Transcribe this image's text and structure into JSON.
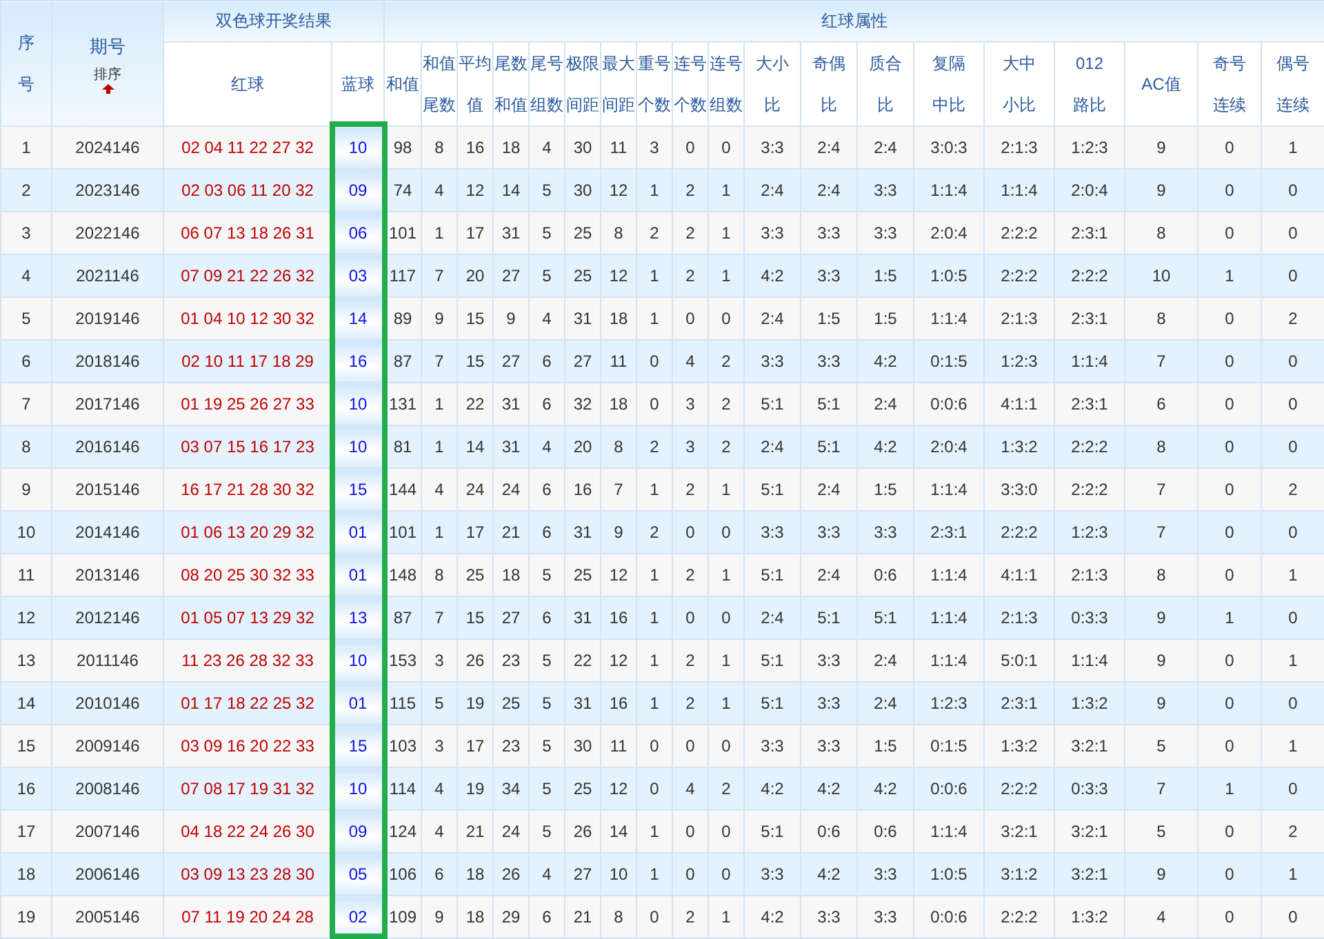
{
  "table": {
    "header": {
      "index": {
        "lines": [
          "序",
          "号"
        ]
      },
      "issue": {
        "lines": [
          "期号"
        ],
        "sort_label": "排序",
        "sort_ascending": true
      },
      "groups": [
        {
          "label": "双色球开奖结果",
          "columns": [
            {
              "lines": [
                "红球"
              ]
            },
            {
              "lines": [
                "蓝球"
              ]
            }
          ]
        },
        {
          "label": "红球属性",
          "columns": [
            {
              "lines": [
                "和值"
              ]
            },
            {
              "lines": [
                "和值",
                "尾数"
              ]
            },
            {
              "lines": [
                "平均",
                "值"
              ]
            },
            {
              "lines": [
                "尾数",
                "和值"
              ]
            },
            {
              "lines": [
                "尾号",
                "组数"
              ]
            },
            {
              "lines": [
                "极限",
                "间距"
              ]
            },
            {
              "lines": [
                "最大",
                "间距"
              ]
            },
            {
              "lines": [
                "重号",
                "个数"
              ]
            },
            {
              "lines": [
                "连号",
                "个数"
              ]
            },
            {
              "lines": [
                "连号",
                "组数"
              ]
            },
            {
              "lines": [
                "大小",
                "比"
              ]
            },
            {
              "lines": [
                "奇偶",
                "比"
              ]
            },
            {
              "lines": [
                "质合",
                "比"
              ]
            },
            {
              "lines": [
                "复隔",
                "中比"
              ]
            },
            {
              "lines": [
                "大中",
                "小比"
              ]
            },
            {
              "lines": [
                "012",
                "路比"
              ]
            },
            {
              "lines": [
                "AC值"
              ]
            },
            {
              "lines": [
                "奇号",
                "连续"
              ]
            },
            {
              "lines": [
                "偶号",
                "连续"
              ]
            }
          ]
        }
      ]
    },
    "highlight_blue_column": true,
    "rows": [
      {
        "index": "1",
        "issue": "2024146",
        "red": "02 04 11 22 27 32",
        "blue": "10",
        "attrs": [
          "98",
          "8",
          "16",
          "18",
          "4",
          "30",
          "11",
          "3",
          "0",
          "0",
          "3:3",
          "2:4",
          "2:4",
          "3:0:3",
          "2:1:3",
          "1:2:3",
          "9",
          "0",
          "1"
        ]
      },
      {
        "index": "2",
        "issue": "2023146",
        "red": "02 03 06 11 20 32",
        "blue": "09",
        "attrs": [
          "74",
          "4",
          "12",
          "14",
          "5",
          "30",
          "12",
          "1",
          "2",
          "1",
          "2:4",
          "2:4",
          "3:3",
          "1:1:4",
          "1:1:4",
          "2:0:4",
          "9",
          "0",
          "0"
        ]
      },
      {
        "index": "3",
        "issue": "2022146",
        "red": "06 07 13 18 26 31",
        "blue": "06",
        "attrs": [
          "101",
          "1",
          "17",
          "31",
          "5",
          "25",
          "8",
          "2",
          "2",
          "1",
          "3:3",
          "3:3",
          "3:3",
          "2:0:4",
          "2:2:2",
          "2:3:1",
          "8",
          "0",
          "0"
        ]
      },
      {
        "index": "4",
        "issue": "2021146",
        "red": "07 09 21 22 26 32",
        "blue": "03",
        "attrs": [
          "117",
          "7",
          "20",
          "27",
          "5",
          "25",
          "12",
          "1",
          "2",
          "1",
          "4:2",
          "3:3",
          "1:5",
          "1:0:5",
          "2:2:2",
          "2:2:2",
          "10",
          "1",
          "0"
        ]
      },
      {
        "index": "5",
        "issue": "2019146",
        "red": "01 04 10 12 30 32",
        "blue": "14",
        "attrs": [
          "89",
          "9",
          "15",
          "9",
          "4",
          "31",
          "18",
          "1",
          "0",
          "0",
          "2:4",
          "1:5",
          "1:5",
          "1:1:4",
          "2:1:3",
          "2:3:1",
          "8",
          "0",
          "2"
        ]
      },
      {
        "index": "6",
        "issue": "2018146",
        "red": "02 10 11 17 18 29",
        "blue": "16",
        "attrs": [
          "87",
          "7",
          "15",
          "27",
          "6",
          "27",
          "11",
          "0",
          "4",
          "2",
          "3:3",
          "3:3",
          "4:2",
          "0:1:5",
          "1:2:3",
          "1:1:4",
          "7",
          "0",
          "0"
        ]
      },
      {
        "index": "7",
        "issue": "2017146",
        "red": "01 19 25 26 27 33",
        "blue": "10",
        "attrs": [
          "131",
          "1",
          "22",
          "31",
          "6",
          "32",
          "18",
          "0",
          "3",
          "2",
          "5:1",
          "5:1",
          "2:4",
          "0:0:6",
          "4:1:1",
          "2:3:1",
          "6",
          "0",
          "0"
        ]
      },
      {
        "index": "8",
        "issue": "2016146",
        "red": "03 07 15 16 17 23",
        "blue": "10",
        "attrs": [
          "81",
          "1",
          "14",
          "31",
          "4",
          "20",
          "8",
          "2",
          "3",
          "2",
          "2:4",
          "5:1",
          "4:2",
          "2:0:4",
          "1:3:2",
          "2:2:2",
          "8",
          "0",
          "0"
        ]
      },
      {
        "index": "9",
        "issue": "2015146",
        "red": "16 17 21 28 30 32",
        "blue": "15",
        "attrs": [
          "144",
          "4",
          "24",
          "24",
          "6",
          "16",
          "7",
          "1",
          "2",
          "1",
          "5:1",
          "2:4",
          "1:5",
          "1:1:4",
          "3:3:0",
          "2:2:2",
          "7",
          "0",
          "2"
        ]
      },
      {
        "index": "10",
        "issue": "2014146",
        "red": "01 06 13 20 29 32",
        "blue": "01",
        "attrs": [
          "101",
          "1",
          "17",
          "21",
          "6",
          "31",
          "9",
          "2",
          "0",
          "0",
          "3:3",
          "3:3",
          "3:3",
          "2:3:1",
          "2:2:2",
          "1:2:3",
          "7",
          "0",
          "0"
        ]
      },
      {
        "index": "11",
        "issue": "2013146",
        "red": "08 20 25 30 32 33",
        "blue": "01",
        "attrs": [
          "148",
          "8",
          "25",
          "18",
          "5",
          "25",
          "12",
          "1",
          "2",
          "1",
          "5:1",
          "2:4",
          "0:6",
          "1:1:4",
          "4:1:1",
          "2:1:3",
          "8",
          "0",
          "1"
        ]
      },
      {
        "index": "12",
        "issue": "2012146",
        "red": "01 05 07 13 29 32",
        "blue": "13",
        "attrs": [
          "87",
          "7",
          "15",
          "27",
          "6",
          "31",
          "16",
          "1",
          "0",
          "0",
          "2:4",
          "5:1",
          "5:1",
          "1:1:4",
          "2:1:3",
          "0:3:3",
          "9",
          "1",
          "0"
        ]
      },
      {
        "index": "13",
        "issue": "2011146",
        "red": "11 23 26 28 32 33",
        "blue": "10",
        "attrs": [
          "153",
          "3",
          "26",
          "23",
          "5",
          "22",
          "12",
          "1",
          "2",
          "1",
          "5:1",
          "3:3",
          "2:4",
          "1:1:4",
          "5:0:1",
          "1:1:4",
          "9",
          "0",
          "1"
        ]
      },
      {
        "index": "14",
        "issue": "2010146",
        "red": "01 17 18 22 25 32",
        "blue": "01",
        "attrs": [
          "115",
          "5",
          "19",
          "25",
          "5",
          "31",
          "16",
          "1",
          "2",
          "1",
          "5:1",
          "3:3",
          "2:4",
          "1:2:3",
          "2:3:1",
          "1:3:2",
          "9",
          "0",
          "0"
        ]
      },
      {
        "index": "15",
        "issue": "2009146",
        "red": "03 09 16 20 22 33",
        "blue": "15",
        "attrs": [
          "103",
          "3",
          "17",
          "23",
          "5",
          "30",
          "11",
          "0",
          "0",
          "0",
          "3:3",
          "3:3",
          "1:5",
          "0:1:5",
          "1:3:2",
          "3:2:1",
          "5",
          "0",
          "1"
        ]
      },
      {
        "index": "16",
        "issue": "2008146",
        "red": "07 08 17 19 31 32",
        "blue": "10",
        "attrs": [
          "114",
          "4",
          "19",
          "34",
          "5",
          "25",
          "12",
          "0",
          "4",
          "2",
          "4:2",
          "4:2",
          "4:2",
          "0:0:6",
          "2:2:2",
          "0:3:3",
          "7",
          "1",
          "0"
        ]
      },
      {
        "index": "17",
        "issue": "2007146",
        "red": "04 18 22 24 26 30",
        "blue": "09",
        "attrs": [
          "124",
          "4",
          "21",
          "24",
          "5",
          "26",
          "14",
          "1",
          "0",
          "0",
          "5:1",
          "0:6",
          "0:6",
          "1:1:4",
          "3:2:1",
          "3:2:1",
          "5",
          "0",
          "2"
        ]
      },
      {
        "index": "18",
        "issue": "2006146",
        "red": "03 09 13 23 28 30",
        "blue": "05",
        "attrs": [
          "106",
          "6",
          "18",
          "26",
          "4",
          "27",
          "10",
          "1",
          "0",
          "0",
          "3:3",
          "4:2",
          "3:3",
          "1:0:5",
          "3:1:2",
          "3:2:1",
          "9",
          "0",
          "1"
        ]
      },
      {
        "index": "19",
        "issue": "2005146",
        "red": "07 11 19 20 24 28",
        "blue": "02",
        "attrs": [
          "109",
          "9",
          "18",
          "29",
          "6",
          "21",
          "8",
          "0",
          "2",
          "1",
          "4:2",
          "3:3",
          "3:3",
          "0:0:6",
          "2:2:2",
          "1:3:2",
          "4",
          "0",
          "0"
        ]
      }
    ]
  }
}
